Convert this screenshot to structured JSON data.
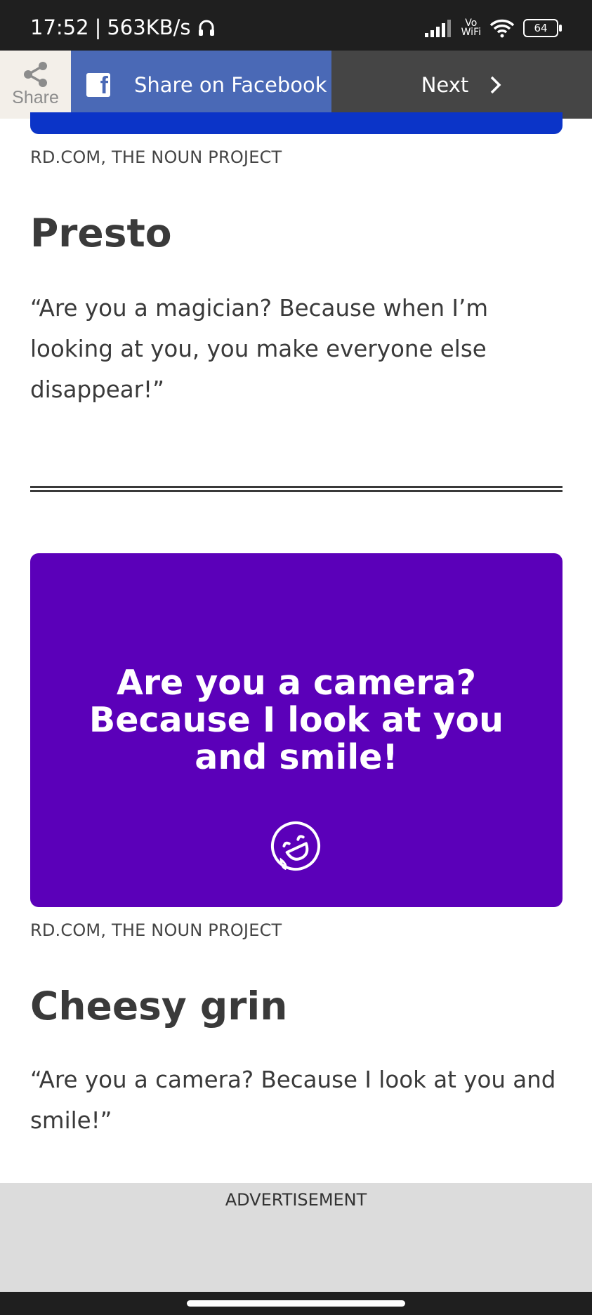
{
  "status_bar": {
    "time": "17:52",
    "net_speed": "563KB/s",
    "vowifi_top": "Vo",
    "vowifi_bottom": "WiFi",
    "battery": "64",
    "icons": [
      "headset-icon",
      "signal-icon",
      "wifi-icon",
      "battery-icon"
    ]
  },
  "share_bar": {
    "share_label": "Share",
    "facebook_label": "Share on Facebook",
    "next_label": "Next",
    "colors": {
      "share_bg": "#f3efe9",
      "facebook_bg": "#4a69b6",
      "next_bg": "#454545"
    }
  },
  "article": {
    "credit_1": "RD.COM, THE NOUN PROJECT",
    "heading_1": "Presto",
    "body_1": "“Are you a magician? Because when I’m looking at you, you make everyone else disappear!”",
    "card": {
      "lines": [
        "Are you a camera?",
        "Because I look at you",
        "and smile!"
      ],
      "icon": "laughing-face-icon",
      "bg_color": "#5b00b9"
    },
    "credit_2": "RD.COM, THE NOUN PROJECT",
    "heading_2": "Cheesy grin",
    "body_2": "“Are you a camera? Because I look at you and smile!”"
  },
  "ad": {
    "label": "ADVERTISEMENT"
  }
}
